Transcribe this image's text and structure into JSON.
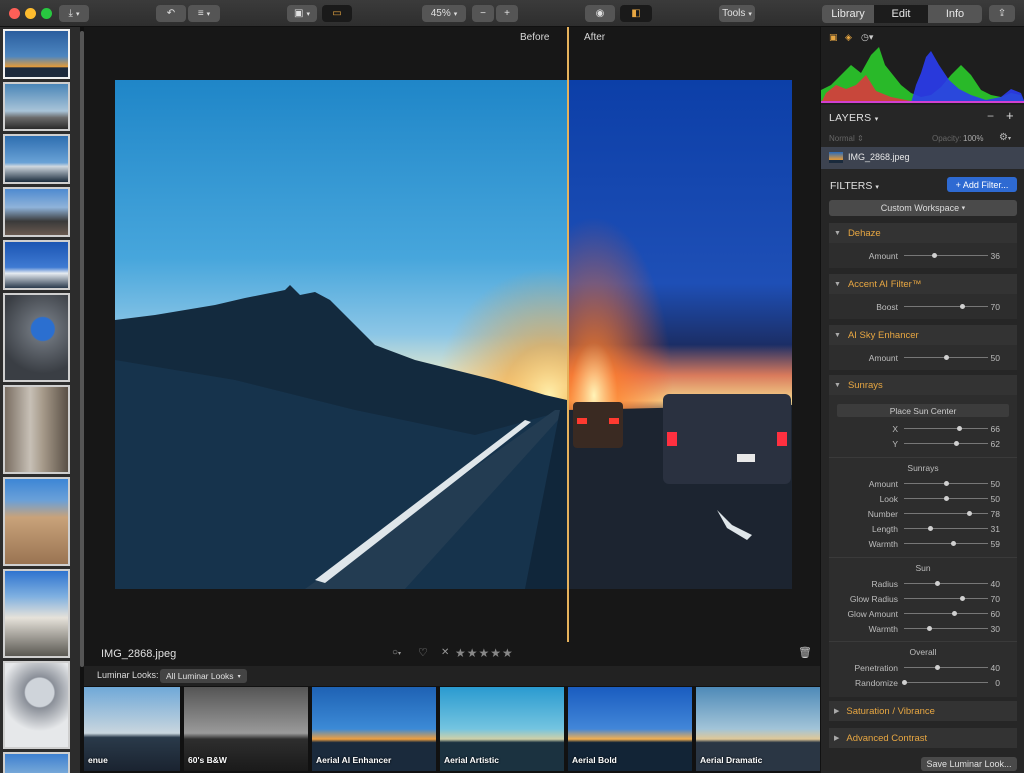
{
  "toolbar": {
    "zoom": "45%",
    "tools": "Tools",
    "tabs": [
      {
        "label": "Library",
        "active": false
      },
      {
        "label": "Edit",
        "active": true
      },
      {
        "label": "Info",
        "active": false
      }
    ]
  },
  "viewer": {
    "before_label": "Before",
    "after_label": "After",
    "filename": "IMG_2868.jpeg",
    "rating_stars": "★★★★★",
    "reject_mark": "✕"
  },
  "looks": {
    "label": "Luminar Looks:",
    "selector": "All Luminar Looks",
    "items": [
      "enue",
      "60's B&W",
      "Aerial AI Enhancer",
      "Aerial Artistic",
      "Aerial Bold",
      "Aerial Dramatic"
    ]
  },
  "panel": {
    "layers_title": "LAYERS",
    "blend_mode": "Normal",
    "opacity_label": "Opacity:",
    "opacity_value": "100%",
    "layer_name": "IMG_2868.jpeg",
    "filters_title": "FILTERS",
    "add_filter": "+ Add Filter...",
    "workspace": "Custom Workspace",
    "dehaze": {
      "title": "Dehaze",
      "amount_label": "Amount",
      "amount": 36
    },
    "accent": {
      "title": "Accent AI Filter™",
      "boost_label": "Boost",
      "boost": 70
    },
    "sky": {
      "title": "AI Sky Enhancer",
      "amount_label": "Amount",
      "amount": 50
    },
    "sunrays": {
      "title": "Sunrays",
      "place_sun": "Place Sun Center",
      "x_label": "X",
      "x": 66,
      "y_label": "Y",
      "y": 62,
      "group_sunrays": "Sunrays",
      "amount_label": "Amount",
      "amount": 50,
      "look_label": "Look",
      "look": 50,
      "number_label": "Number",
      "number": 78,
      "length_label": "Length",
      "length": 31,
      "warmth_label": "Warmth",
      "warmth": 59,
      "group_sun": "Sun",
      "radius_label": "Radius",
      "radius": 40,
      "glow_radius_label": "Glow Radius",
      "glow_radius": 70,
      "glow_amount_label": "Glow Amount",
      "glow_amount": 60,
      "sun_warmth_label": "Warmth",
      "sun_warmth": 30,
      "group_overall": "Overall",
      "penetration_label": "Penetration",
      "penetration": 40,
      "randomize_label": "Randomize",
      "randomize": 0
    },
    "saturation_title": "Saturation / Vibrance",
    "contrast_title": "Advanced Contrast",
    "save_look": "Save Luminar Look..."
  }
}
